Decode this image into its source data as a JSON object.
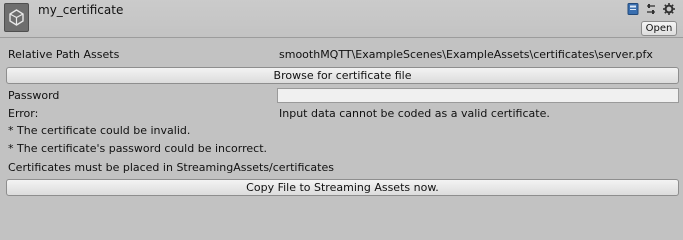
{
  "header": {
    "title": "my_certificate",
    "open_label": "Open",
    "icons": [
      "unity-asset-icon",
      "book-icon",
      "preset-icon",
      "gear-icon"
    ]
  },
  "fields": {
    "relative_path_label": "Relative Path Assets",
    "relative_path_value": "smoothMQTT\\ExampleScenes\\ExampleAssets\\certificates\\server.pfx",
    "browse_label": "Browse for certificate file",
    "password_label": "Password",
    "password_value": "",
    "error_label": "Error:",
    "error_value": "Input data cannot be coded as a valid certificate.",
    "note_invalid": "* The certificate could be invalid.",
    "note_password": "* The certificate's password could be incorrect.",
    "placement_note": "Certificates must be placed in StreamingAssets/certificates",
    "copy_label": "Copy File to Streaming Assets now."
  }
}
